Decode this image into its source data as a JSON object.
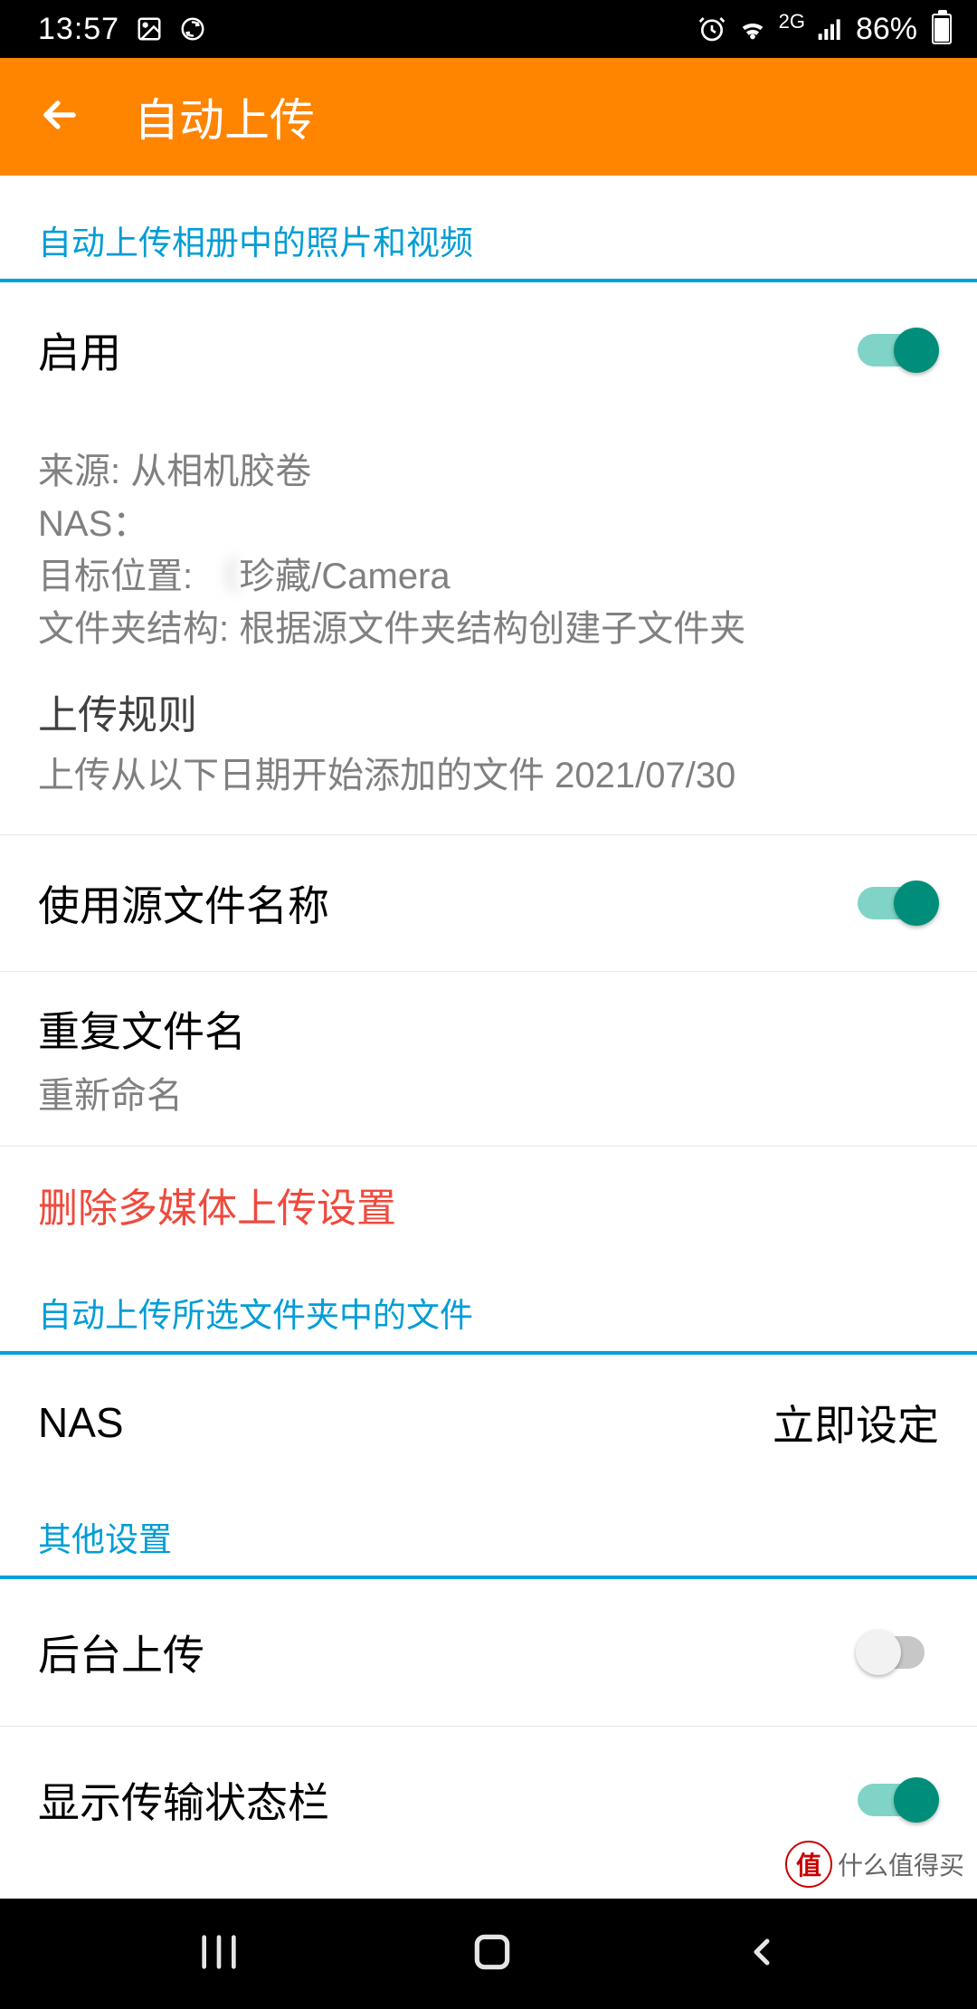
{
  "status_bar": {
    "time": "13:57",
    "battery_pct": "86%",
    "network": "2G"
  },
  "app_bar": {
    "title": "自动上传"
  },
  "section1": {
    "header": "自动上传相册中的照片和视频",
    "enable_label": "启用",
    "enable_on": true,
    "info": {
      "source_label": "来源:",
      "source_value": "从相机胶卷",
      "nas_label": "NAS：",
      "nas_value": " ",
      "target_label": "目标位置:",
      "target_value_blurred": "（  ",
      "target_value_tail": "珍藏/Camera",
      "folder_label": "文件夹结构:",
      "folder_value": "根据源文件夹结构创建子文件夹"
    },
    "rule": {
      "title": "上传规则",
      "sub": "上传从以下日期开始添加的文件 2021/07/30"
    },
    "use_source_name_label": "使用源文件名称",
    "use_source_name_on": true,
    "dup": {
      "title": "重复文件名",
      "sub": "重新命名"
    },
    "delete_label": "删除多媒体上传设置"
  },
  "section2": {
    "header": "自动上传所选文件夹中的文件",
    "nas_label": "NAS",
    "nas_action": "立即设定"
  },
  "section3": {
    "header": "其他设置",
    "background_label": "后台上传",
    "background_on": false,
    "status_bar_label": "显示传输状态栏",
    "status_bar_on": true
  },
  "watermark": {
    "badge": "值",
    "text": "什么值得买"
  }
}
